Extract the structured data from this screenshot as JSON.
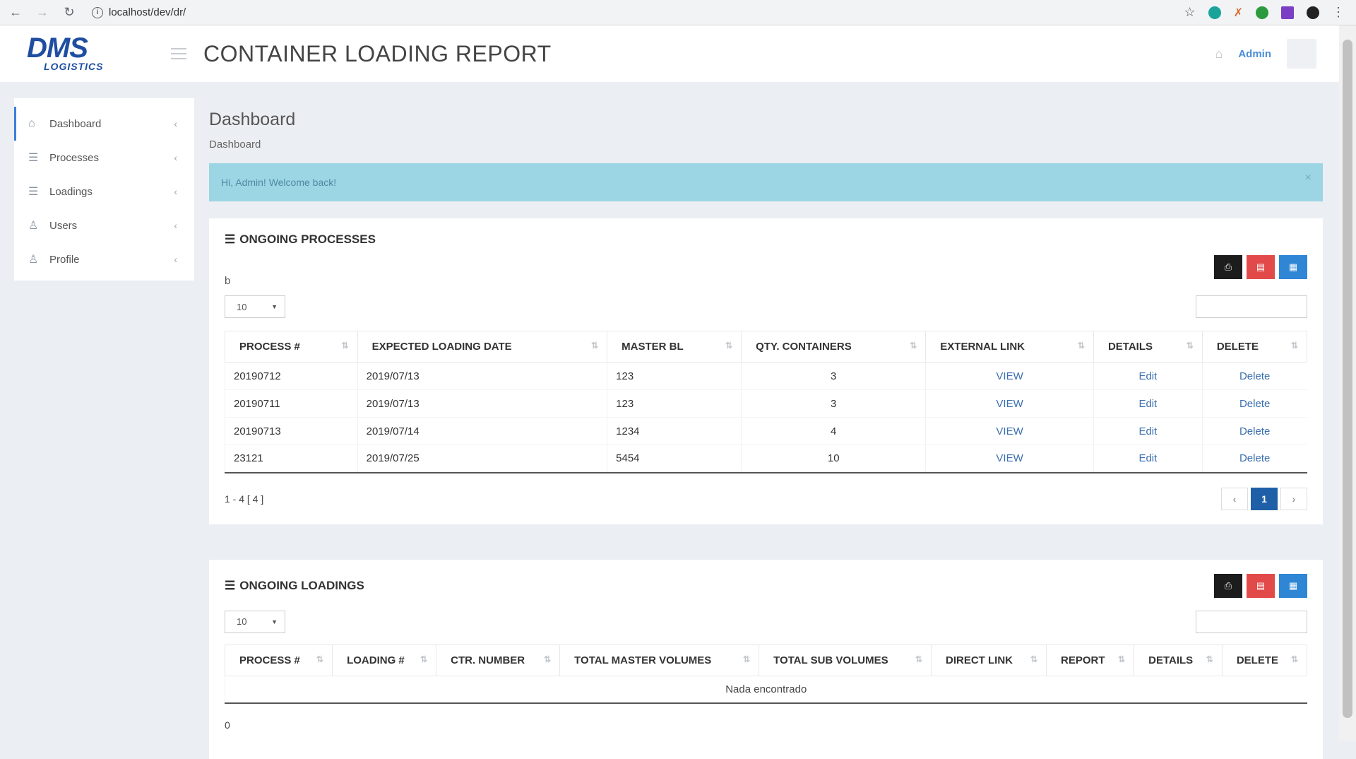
{
  "browser": {
    "url": "localhost/dev/dr/"
  },
  "header": {
    "logo_main": "DMS",
    "logo_sub": "LOGISTICS",
    "title": "CONTAINER LOADING REPORT",
    "user": "Admin"
  },
  "sidebar": {
    "items": [
      {
        "label": "Dashboard",
        "icon": "home-icon"
      },
      {
        "label": "Processes",
        "icon": "list-icon"
      },
      {
        "label": "Loadings",
        "icon": "list-icon"
      },
      {
        "label": "Users",
        "icon": "user-icon"
      },
      {
        "label": "Profile",
        "icon": "user-icon"
      }
    ]
  },
  "main": {
    "heading": "Dashboard",
    "breadcrumb": "Dashboard",
    "alert": "Hi, Admin! Welcome back!",
    "processes": {
      "title": "ONGOING PROCESSES",
      "stray": "b",
      "page_size": "10",
      "columns": [
        "PROCESS #",
        "EXPECTED LOADING DATE",
        "MASTER BL",
        "QTY. CONTAINERS",
        "EXTERNAL LINK",
        "DETAILS",
        "DELETE"
      ],
      "rows": [
        [
          "20190712",
          "2019/07/13",
          "123",
          "3",
          "VIEW",
          "Edit",
          "Delete"
        ],
        [
          "20190711",
          "2019/07/13",
          "123",
          "3",
          "VIEW",
          "Edit",
          "Delete"
        ],
        [
          "20190713",
          "2019/07/14",
          "1234",
          "4",
          "VIEW",
          "Edit",
          "Delete"
        ],
        [
          "23121",
          "2019/07/25",
          "5454",
          "10",
          "VIEW",
          "Edit",
          "Delete"
        ]
      ],
      "summary": "1 - 4 [ 4 ]",
      "page": "1"
    },
    "loadings": {
      "title": "ONGOING LOADINGS",
      "page_size": "10",
      "columns": [
        "PROCESS #",
        "LOADING #",
        "CTR. NUMBER",
        "TOTAL MASTER VOLUMES",
        "TOTAL SUB VOLUMES",
        "DIRECT LINK",
        "REPORT",
        "DETAILS",
        "DELETE"
      ],
      "empty": "Nada encontrado",
      "summary": "0"
    }
  }
}
